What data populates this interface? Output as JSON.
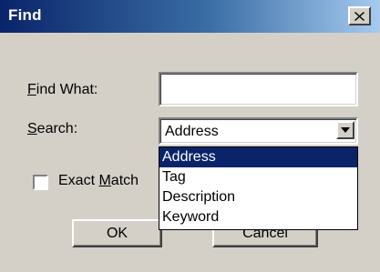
{
  "window": {
    "title": "Find",
    "close_glyph": "✕"
  },
  "find_what": {
    "label_accel": "F",
    "label_rest": "ind What:",
    "value": ""
  },
  "search": {
    "label_accel": "S",
    "label_rest": "earch:",
    "selected": "Address",
    "options": [
      "Address",
      "Tag",
      "Description",
      "Keyword"
    ]
  },
  "exact_match": {
    "label_pre": "Exact ",
    "label_accel": "M",
    "label_post": "atch",
    "checked": false
  },
  "buttons": {
    "ok_label": "OK",
    "cancel_label": "Cancel"
  },
  "colors": {
    "title_start": "#0a246a",
    "selection": "#0a246a",
    "face": "#d4d0c8"
  }
}
